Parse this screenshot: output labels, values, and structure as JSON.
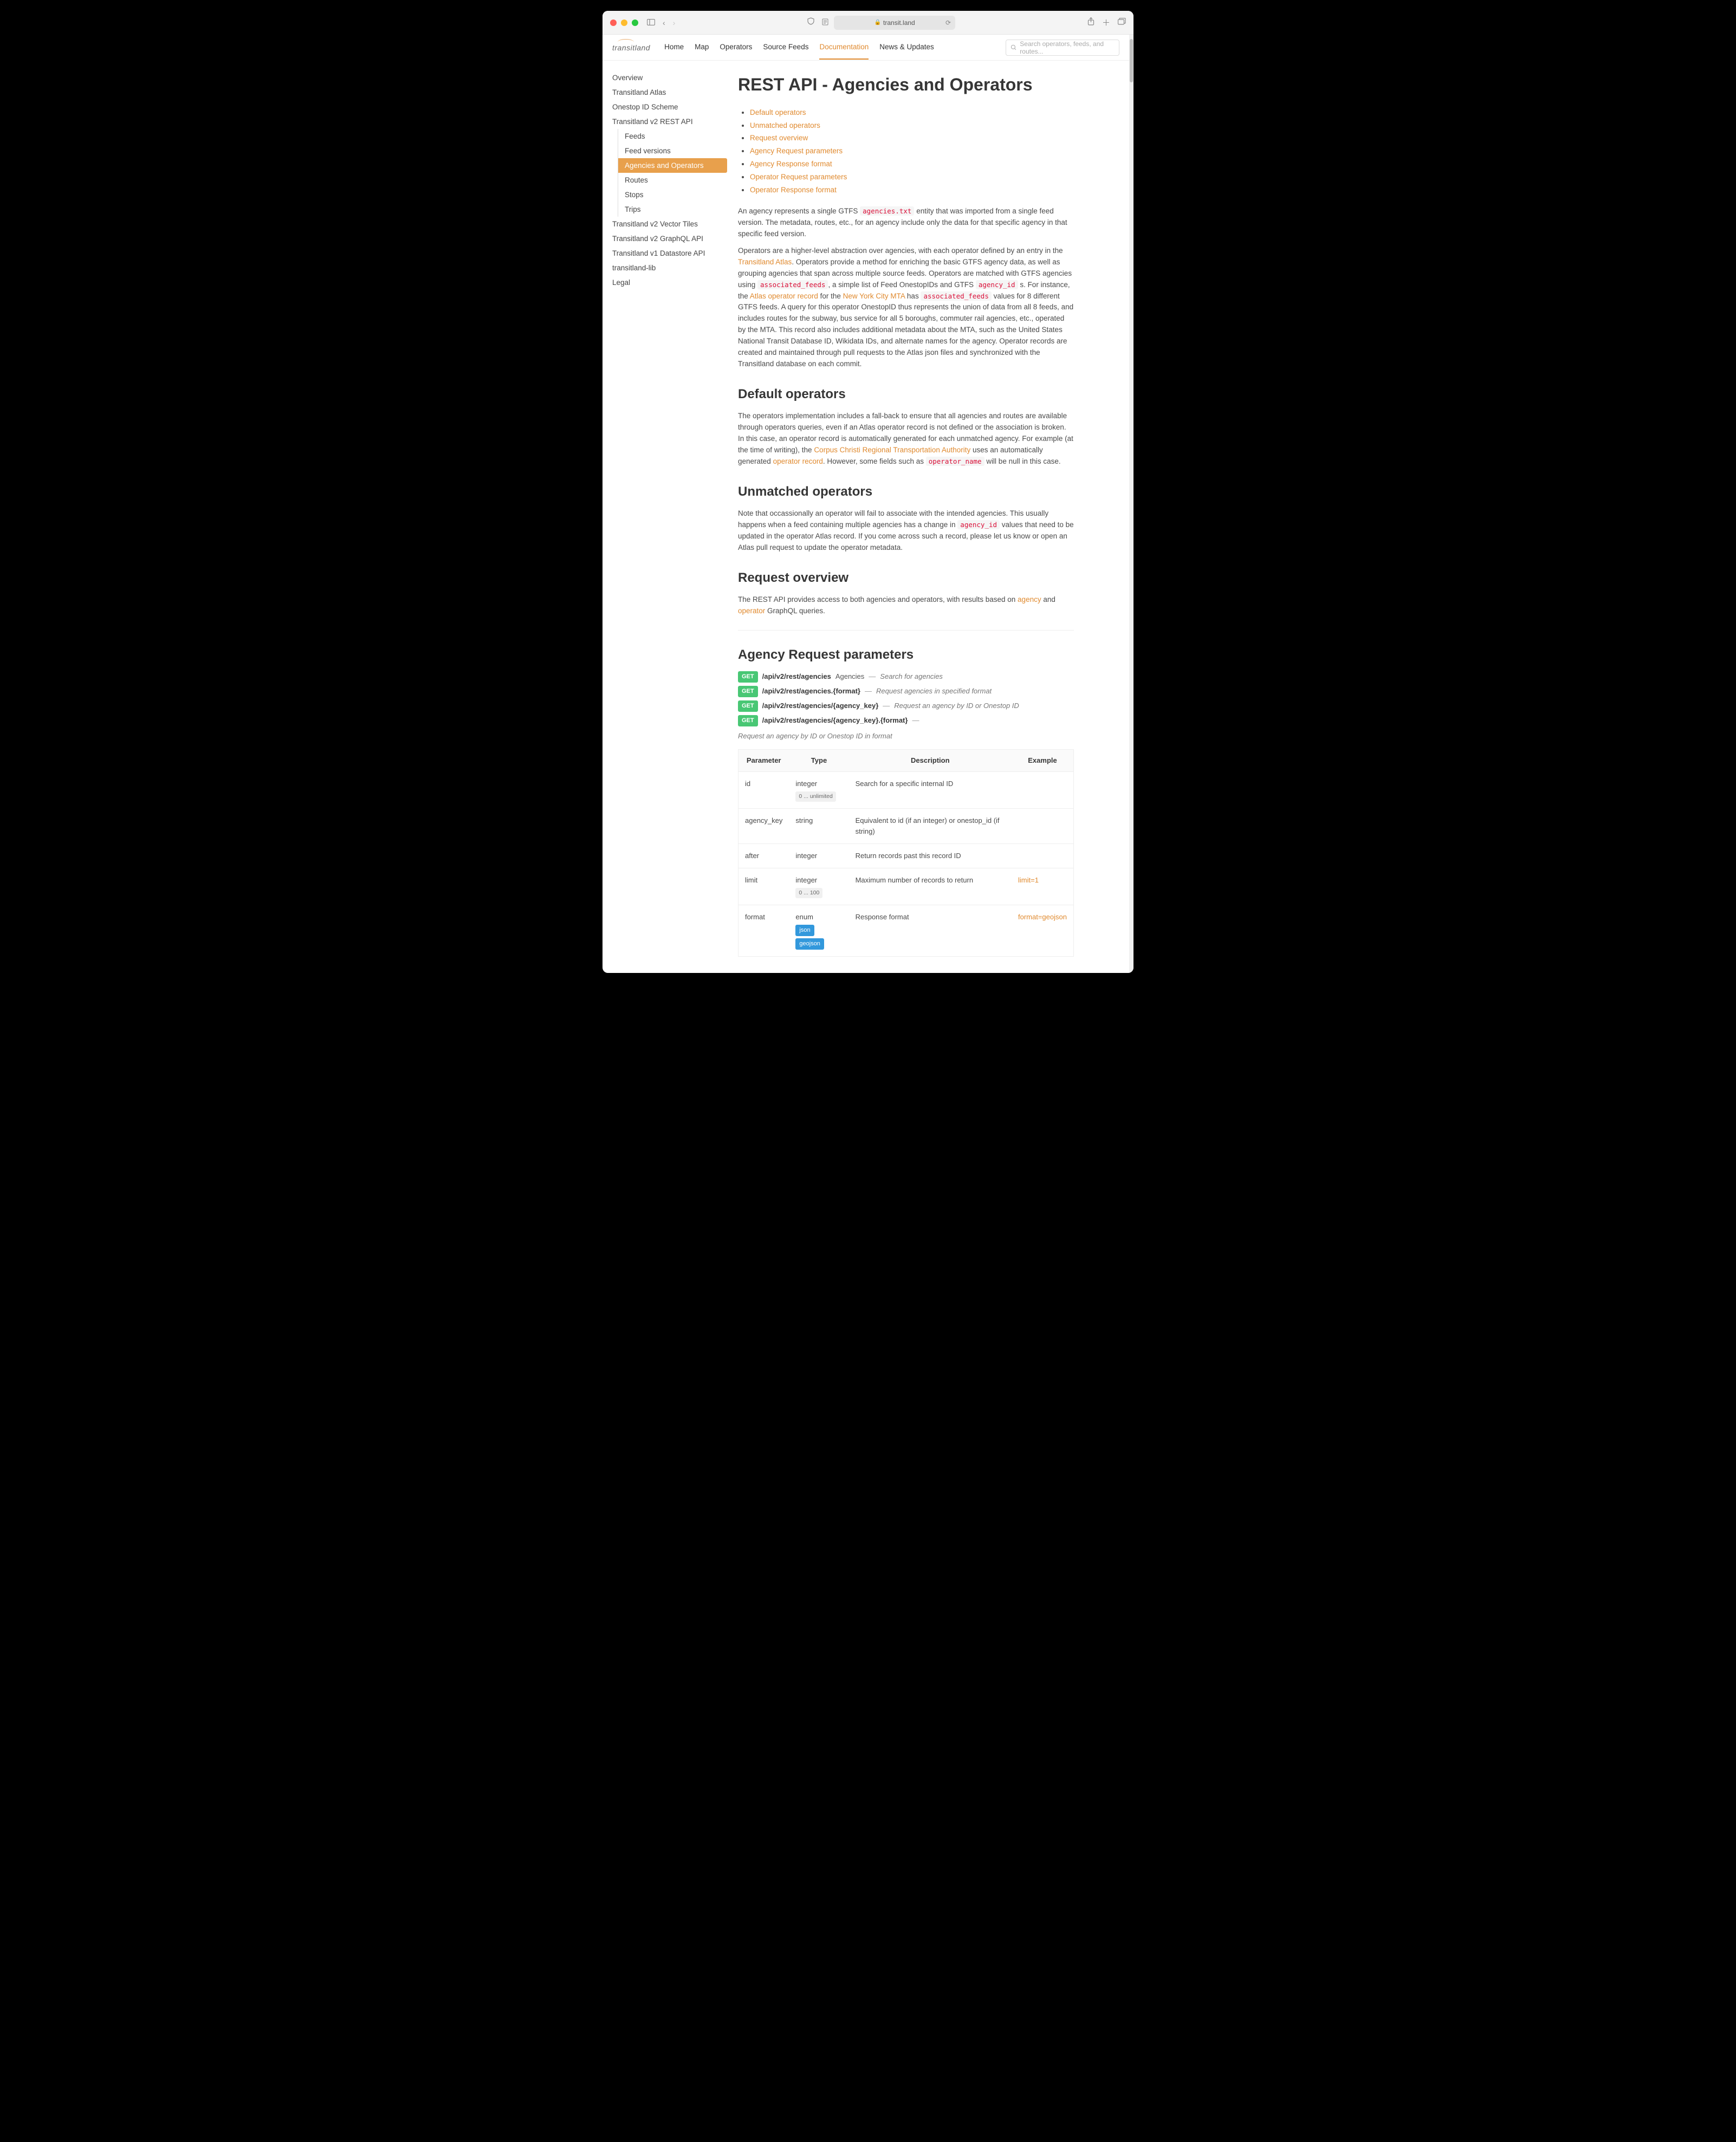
{
  "browser": {
    "url": "transit.land"
  },
  "header": {
    "logo": "transitland",
    "nav": [
      "Home",
      "Map",
      "Operators",
      "Source Feeds",
      "Documentation",
      "News & Updates"
    ],
    "nav_active_index": 4,
    "search_placeholder": "Search operators, feeds, and routes..."
  },
  "sidebar": {
    "items": [
      "Overview",
      "Transitland Atlas",
      "Onestop ID Scheme",
      "Transitland v2 REST API"
    ],
    "sub_items": [
      "Feeds",
      "Feed versions",
      "Agencies and Operators",
      "Routes",
      "Stops",
      "Trips"
    ],
    "sub_active_index": 2,
    "items_after": [
      "Transitland v2 Vector Tiles",
      "Transitland v2 GraphQL API",
      "Transitland v1 Datastore API",
      "transitland-lib",
      "Legal"
    ]
  },
  "page": {
    "title": "REST API - Agencies and Operators",
    "toc": [
      "Default operators",
      "Unmatched operators",
      "Request overview",
      "Agency Request parameters",
      "Agency Response format",
      "Operator Request parameters",
      "Operator Response format"
    ],
    "intro_1a": "An agency represents a single GTFS ",
    "intro_1_code": "agencies.txt",
    "intro_1b": " entity that was imported from a single feed version. The metadata, routes, etc., for an agency include only the data for that specific agency in that specific feed version.",
    "intro_2a": "Operators are a higher-level abstraction over agencies, with each operator defined by an entry in the ",
    "intro_2_link1": "Transitland Atlas",
    "intro_2b": ". Operators provide a method for enriching the basic GTFS agency data, as well as grouping agencies that span across multiple source feeds. Operators are matched with GTFS agencies using ",
    "intro_2_code1": "associated_feeds",
    "intro_2c": ", a simple list of Feed OnestopIDs and GTFS ",
    "intro_2_code2": "agency_id",
    "intro_2d": " s. For instance, the ",
    "intro_2_link2": "Atlas operator record",
    "intro_2e": " for the ",
    "intro_2_link3": "New York City MTA",
    "intro_2f": " has ",
    "intro_2_code3": "associated_feeds",
    "intro_2g": " values for 8 different GTFS feeds. A query for this operator OnestopID thus represents the union of data from all 8 feeds, and includes routes for the subway, bus service for all 5 boroughs, commuter rail agencies, etc., operated by the MTA. This record also includes additional metadata about the MTA, such as the United States National Transit Database ID, Wikidata IDs, and alternate names for the agency. Operator records are created and maintained through pull requests to the Atlas json files and synchronized with the Transitland database on each commit.",
    "h2_default": "Default operators",
    "default_a": "The operators implementation includes a fall-back to ensure that all agencies and routes are available through operators queries, even if an Atlas operator record is not defined or the association is broken. In this case, an operator record is automatically generated for each unmatched agency. For example (at the time of writing), the ",
    "default_link1": "Corpus Christi Regional Transportation Authority",
    "default_b": " uses an automatically generated ",
    "default_link2": "operator record",
    "default_c": ". However, some fields such as ",
    "default_code": "operator_name",
    "default_d": " will be null in this case.",
    "h2_unmatched": "Unmatched operators",
    "unmatched_a": "Note that occassionally an operator will fail to associate with the intended agencies. This usually happens when a feed containing multiple agencies has a change in ",
    "unmatched_code": "agency_id",
    "unmatched_b": " values that need to be updated in the operator Atlas record. If you come across such a record, please let us know or open an Atlas pull request to update the operator metadata.",
    "h2_request": "Request overview",
    "request_a": "The REST API provides access to both agencies and operators, with results based on ",
    "request_link1": "agency",
    "request_b": " and ",
    "request_link2": "operator",
    "request_c": " GraphQL queries.",
    "h2_params": "Agency Request parameters",
    "endpoints": [
      {
        "method": "GET",
        "path": "/api/v2/rest/agencies",
        "desc": "Agencies",
        "sub": "Search for agencies"
      },
      {
        "method": "GET",
        "path": "/api/v2/rest/agencies.{format}",
        "desc": "",
        "sub": "Request agencies in specified format"
      },
      {
        "method": "GET",
        "path": "/api/v2/rest/agencies/{agency_key}",
        "desc": "",
        "sub": "Request an agency by ID or Onestop ID"
      },
      {
        "method": "GET",
        "path": "/api/v2/rest/agencies/{agency_key}.{format}",
        "desc": "",
        "sub": "Request an agency by ID or Onestop ID in format"
      }
    ],
    "table": {
      "headers": [
        "Parameter",
        "Type",
        "Description",
        "Example"
      ],
      "rows": [
        {
          "param": "id",
          "type": "integer",
          "type_tag": "0 ... unlimited",
          "desc": "Search for a specific internal ID",
          "example": ""
        },
        {
          "param": "agency_key",
          "type": "string",
          "type_tag": "",
          "desc": "Equivalent to id (if an integer) or onestop_id (if string)",
          "example": ""
        },
        {
          "param": "after",
          "type": "integer",
          "type_tag": "",
          "desc": "Return records past this record ID",
          "example": ""
        },
        {
          "param": "limit",
          "type": "integer",
          "type_tag": "0 ... 100",
          "desc": "Maximum number of records to return",
          "example": "limit=1"
        },
        {
          "param": "format",
          "type": "enum",
          "type_tag": "",
          "enum": [
            "json",
            "geojson"
          ],
          "desc": "Response format",
          "example": "format=geojson"
        }
      ]
    }
  }
}
